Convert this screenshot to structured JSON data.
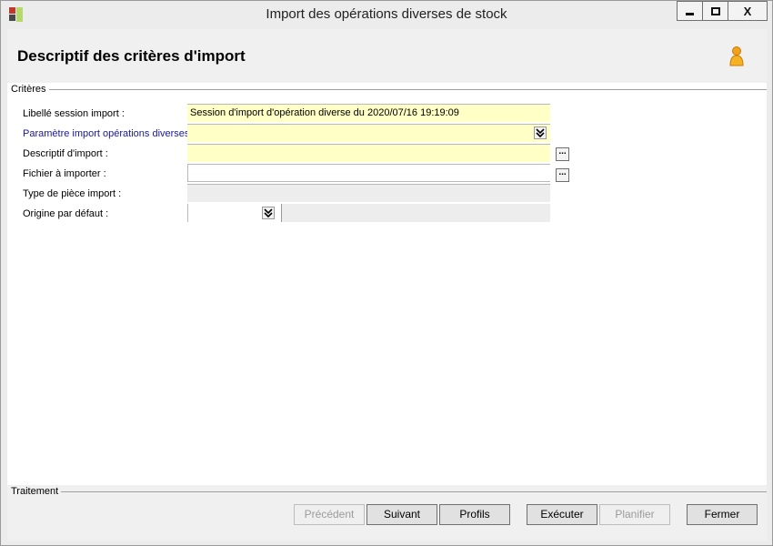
{
  "window": {
    "title": "Import des opérations diverses de stock",
    "minimize_glyph": "▁",
    "maximize_glyph": "□",
    "close_glyph": "X"
  },
  "header": {
    "title": "Descriptif des critères d'import",
    "user_icon": "user-icon"
  },
  "criteria": {
    "group_label": "Critères",
    "fields": [
      {
        "label": "Libellé session import :",
        "value": "Session d'import d'opération diverse du 2020/07/16 19:19:09"
      },
      {
        "label": "Paramètre import opérations diverses :",
        "value": ""
      },
      {
        "label": "Descriptif d'import :",
        "value": ""
      },
      {
        "label": "Fichier à importer :",
        "value": ""
      },
      {
        "label": "Type de pièce import :",
        "value": ""
      },
      {
        "label": "Origine par défaut :",
        "value": "",
        "description": ""
      }
    ],
    "ellipsis": "..."
  },
  "footer": {
    "group_label": "Traitement",
    "buttons": {
      "previous": "Précédent",
      "next": "Suivant",
      "profiles": "Profils",
      "execute": "Exécuter",
      "schedule": "Planifier",
      "close": "Fermer"
    }
  },
  "colors": {
    "required_field": "#ffffc6",
    "readonly_field": "#ededed",
    "label_link": "#1a1a8c"
  }
}
